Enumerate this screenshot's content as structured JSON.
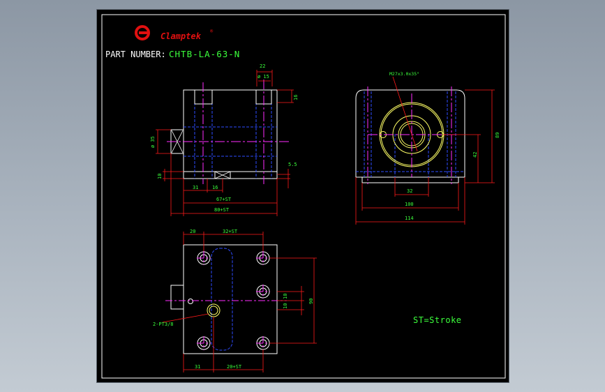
{
  "brand": {
    "name": "Clamptek",
    "mark": "®",
    "logo_color": "#e01010"
  },
  "title_block": {
    "part_label": "PART  NUMBER:",
    "part_number": "CHTB-LA-63-N"
  },
  "note": "ST=Stroke",
  "colors": {
    "background": "#000000",
    "outline": "#ffffff",
    "dimension": "#ff1a1a",
    "dim_text": "#3cff3c",
    "hidden_line": "#2e4bff",
    "center_line": "#ff2bff",
    "bore": "#ffff66"
  },
  "views": {
    "side": {
      "dims": {
        "d22": "22",
        "d15_dia": "ø 15",
        "d16_top": "16",
        "d35": "ø 35",
        "d10": "10",
        "d5_5": "5.5",
        "d31": "31",
        "d16": "16",
        "d67st": "67+ST",
        "d80st": "80+ST"
      }
    },
    "end": {
      "dims": {
        "thread": "M27x3.0x35°",
        "d89": "89",
        "d42": "42",
        "d32": "32",
        "d100": "100",
        "d114": "114"
      }
    },
    "top": {
      "dims": {
        "d20": "20",
        "d32st": "32+ST",
        "port": "2-PT3/8",
        "d10a": "10",
        "d10b": "10",
        "d90": "90",
        "d31": "31",
        "d20st": "20+ST"
      }
    }
  }
}
